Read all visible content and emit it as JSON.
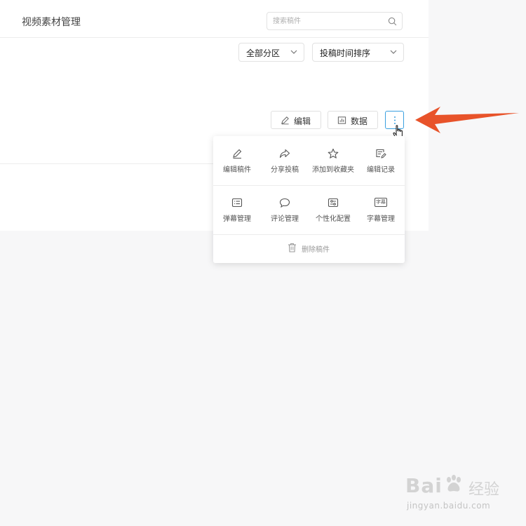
{
  "header": {
    "title": "视频素材管理",
    "search_placeholder": "搜索稿件"
  },
  "filters": {
    "category": "全部分区",
    "sort": "投稿时间排序"
  },
  "actions": {
    "edit_label": "编辑",
    "data_label": "数据"
  },
  "more_menu": {
    "row1": [
      {
        "label": "编辑稿件",
        "icon": "pencil-icon"
      },
      {
        "label": "分享投稿",
        "icon": "share-arrow-icon"
      },
      {
        "label": "添加到收藏夹",
        "icon": "star-icon"
      },
      {
        "label": "编辑记录",
        "icon": "edit-record-icon"
      }
    ],
    "row2": [
      {
        "label": "弹幕管理",
        "icon": "danmaku-icon"
      },
      {
        "label": "评论管理",
        "icon": "comment-icon"
      },
      {
        "label": "个性化配置",
        "icon": "sliders-icon"
      },
      {
        "label": "字幕管理",
        "icon": "subtitle-icon",
        "icon_text": "字幕"
      }
    ],
    "delete_label": "删除稿件"
  },
  "watermark": {
    "logo_text": "Bai",
    "logo_tail": "经验",
    "url": "jingyan.baidu.com"
  },
  "colors": {
    "accent": "#3aa0e0",
    "arrow": "#e8532a"
  }
}
